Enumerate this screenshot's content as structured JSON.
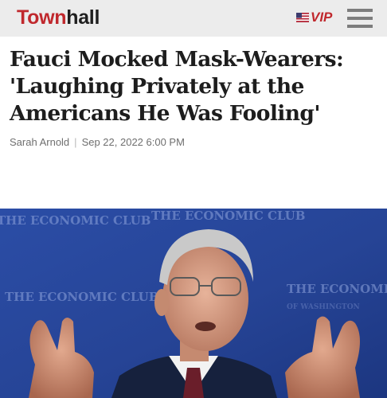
{
  "site": {
    "logo_part1": "Town",
    "logo_part2": "hall",
    "vip_label": "VIP",
    "brand_color": "#c0282d"
  },
  "icons": {
    "flag": "us-flag-icon",
    "menu": "hamburger-menu-icon"
  },
  "article": {
    "headline": "Fauci Mocked Mask-Wearers: 'Laughing Privately at the Americans He Was Fooling'",
    "author": "Sarah Arnold",
    "separator": "|",
    "date": "Sep 22, 2022 6:00 PM"
  },
  "hero_image": {
    "backdrop_texts": [
      "THE ECONOMIC CLUB",
      "THE ECONOMIC CLUB",
      "THE ECONOMIC CLUB",
      "THE ECONOMIC CLUB",
      "OF WASHINGTON"
    ]
  }
}
